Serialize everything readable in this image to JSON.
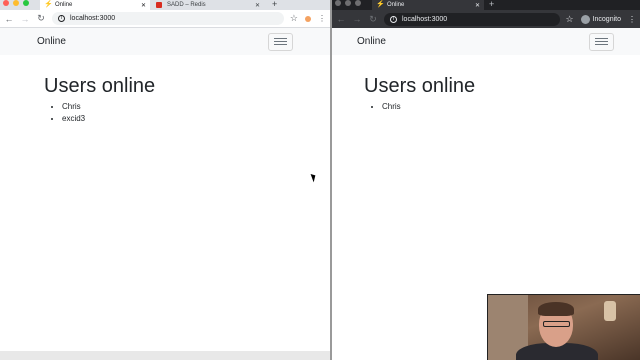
{
  "left_window": {
    "tabs": [
      {
        "title": "Online",
        "active": true
      },
      {
        "title": "SADD – Redis",
        "active": false
      }
    ],
    "new_tab": "+",
    "address": "localhost:3000",
    "navbar": {
      "brand": "Online"
    },
    "heading": "Users online",
    "users": [
      "Chris",
      "excid3"
    ]
  },
  "right_window": {
    "tabs": [
      {
        "title": "Online",
        "active": true
      }
    ],
    "new_tab": "+",
    "address": "localhost:3000",
    "incognito_label": "Incognito",
    "navbar": {
      "brand": "Online"
    },
    "heading": "Users online",
    "users": [
      "Chris"
    ]
  },
  "icons": {
    "back": "arrow-left-icon",
    "forward": "arrow-right-icon",
    "reload": "reload-icon",
    "info": "info-icon",
    "star": "star-icon",
    "menu": "kebab-menu-icon",
    "hamburger": "hamburger-icon",
    "close": "close-icon"
  },
  "colors": {
    "redis_red": "#d82c20",
    "chrome_blue": "#1a73e8",
    "extension_orange": "#f4a261"
  }
}
